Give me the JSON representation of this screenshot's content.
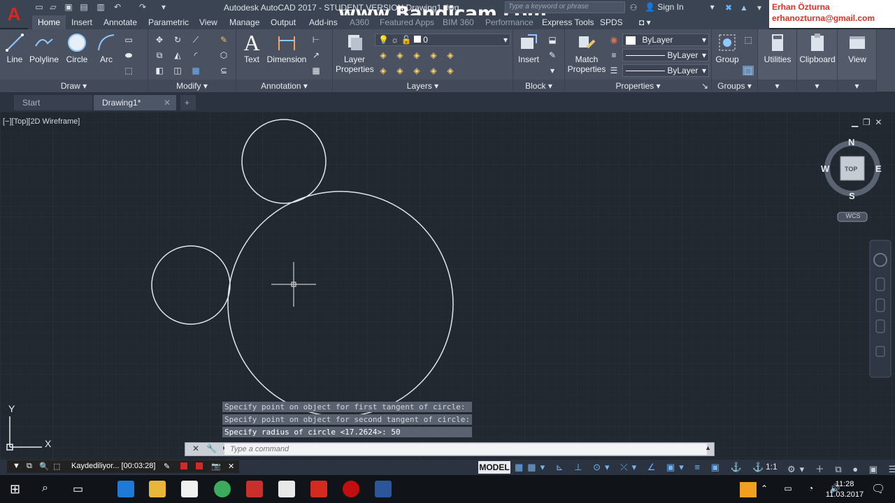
{
  "titlebar": {
    "logo_letter": "A",
    "app_title": "Autodesk AutoCAD 2017 - STUDENT VERSION  Drawing1.dwg",
    "watermark": "www.Bandicam.com",
    "search_placeholder": "Type a keyword or phrase",
    "sign_in": "Sign In",
    "user_name": "Erhan Özturna",
    "user_email": "erhanozturna@gmail.com"
  },
  "ribbon_tabs": [
    "Home",
    "Insert",
    "Annotate",
    "Parametric",
    "View",
    "Manage",
    "Output",
    "Add-ins",
    "A360",
    "Featured Apps",
    "BIM 360",
    "Performance",
    "Express Tools",
    "SPDS"
  ],
  "ribbon": {
    "draw": {
      "title": "Draw",
      "line": "Line",
      "polyline": "Polyline",
      "circle": "Circle",
      "arc": "Arc"
    },
    "modify": {
      "title": "Modify"
    },
    "annotation": {
      "title": "Annotation",
      "text": "Text",
      "dimension": "Dimension"
    },
    "layers": {
      "title": "Layers",
      "layer_properties_1": "Layer",
      "layer_properties_2": "Properties",
      "current_layer": "0"
    },
    "block": {
      "title": "Block",
      "insert": "Insert"
    },
    "properties": {
      "title": "Properties",
      "match_1": "Match",
      "match_2": "Properties",
      "color": "ByLayer",
      "linetype": "ByLayer",
      "lineweight": "ByLayer"
    },
    "groups": {
      "title": "Groups",
      "group": "Group"
    },
    "utilities": "Utilities",
    "clipboard": "Clipboard",
    "view": "View"
  },
  "doc_tabs": {
    "start": "Start",
    "drawing": "Drawing1*"
  },
  "viewport": {
    "label": "[−][Top][2D Wireframe]",
    "compass": {
      "n": "N",
      "s": "S",
      "e": "E",
      "w": "W",
      "top": "TOP",
      "wcs": "WCS"
    },
    "ucs": {
      "x": "X",
      "y": "Y"
    }
  },
  "command": {
    "history": [
      "Specify point on object for first tangent of circle:",
      "Specify point on object for second tangent of circle:",
      "Specify radius of circle <17.2624>: 50"
    ],
    "placeholder": "Type a command"
  },
  "status": {
    "recording": "Kaydediliyor... [00:03:28]",
    "model": "MODEL",
    "scale": "1:1"
  },
  "taskbar": {
    "time": "11:28",
    "date": "11.03.2017"
  }
}
